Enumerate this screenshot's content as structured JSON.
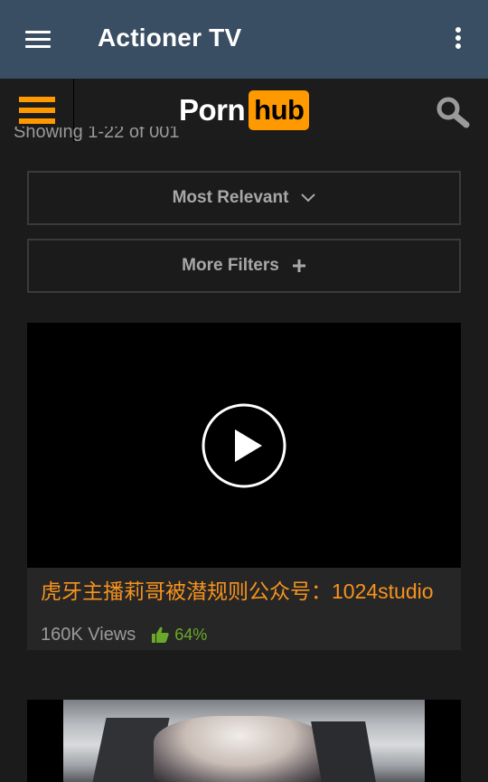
{
  "appbar": {
    "title": "Actioner TV"
  },
  "site": {
    "logo_left": "Porn",
    "logo_right": "hub"
  },
  "results": {
    "showing": "Showing 1-22 of 001"
  },
  "filters": {
    "sort_label": "Most Relevant",
    "more_label": "More Filters"
  },
  "videos": [
    {
      "title": "虎牙主播莉哥被潜规则公众号：1024studio",
      "views": "160K Views",
      "rating": "64%"
    }
  ],
  "colors": {
    "appbar": "#3a4e63",
    "accent": "#ff9900",
    "title": "#f7931e",
    "rating": "#6aa829"
  },
  "icons": [
    "menu-icon",
    "more-vert-icon",
    "hamburger-icon",
    "search-icon",
    "chevron-down-icon",
    "plus-icon",
    "play-icon",
    "thumbs-up-icon"
  ]
}
